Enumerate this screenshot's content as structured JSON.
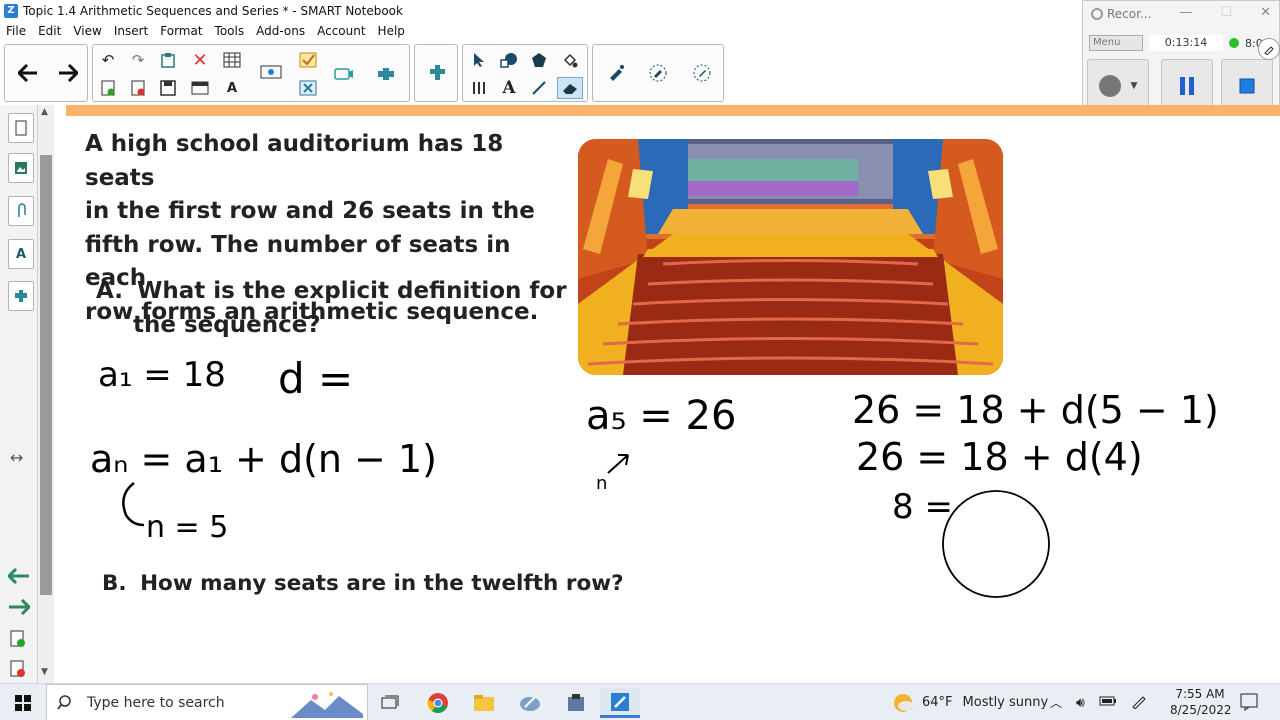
{
  "window": {
    "title": "Topic 1.4 Arithmetic Sequences and Series * - SMART Notebook"
  },
  "menu": [
    "File",
    "Edit",
    "View",
    "Insert",
    "Format",
    "Tools",
    "Add-ons",
    "Account",
    "Help"
  ],
  "toolbar": {
    "icons": [
      "back-arrow-icon",
      "forward-arrow-icon",
      "undo-icon",
      "redo-icon",
      "paste-icon",
      "delete-icon",
      "table-icon",
      "new-page-icon",
      "delete-page-icon",
      "save-icon",
      "screen-shade-icon",
      "text-recognition-icon",
      "document-camera-icon",
      "check-icon",
      "close-box-icon",
      "capture-icon",
      "add-ons-icon",
      "widgets-icon",
      "select-icon",
      "shapes-icon",
      "polygon-icon",
      "fill-icon",
      "measurement-icon",
      "text-icon",
      "line-icon",
      "eraser-icon",
      "magic-pen-icon",
      "highlighter-icon",
      "pen-icon"
    ]
  },
  "recorder": {
    "title": "Recor...",
    "menu": "Menu",
    "elapsed": "0:13:14",
    "remaining": "8:0"
  },
  "problem": {
    "stem_lines": [
      "A high school auditorium has 18 seats",
      "in the first row and 26 seats in the",
      "fifth row. The number of seats in each",
      "row forms an arithmetic sequence."
    ],
    "part_a_label": "A.",
    "part_a_lines": [
      "What is the explicit definition for",
      "the sequence?"
    ],
    "part_b_label": "B.",
    "part_b_text": "How many seats are in the twelfth row?"
  },
  "handwriting": {
    "a1": "a₁ = 18",
    "d": "d =",
    "explicit": "aₙ = a₁ + d(n − 1)",
    "n5": "n = 5",
    "a5": "a₅ = 26",
    "n_arrow": "n",
    "eq1": "26 = 18 + d(5 − 1)",
    "eq2": "26 = 18 + d(4)",
    "eq3": "8 = "
  },
  "taskbar": {
    "search_placeholder": "Type here to search",
    "weather_temp": "64°F",
    "weather_desc": "Mostly sunny",
    "time": "7:55 AM",
    "date": "8/25/2022"
  },
  "colors": {
    "accent_orange": "#f9b26a",
    "ink": "#000000",
    "recorder_green": "#2bc02b"
  }
}
